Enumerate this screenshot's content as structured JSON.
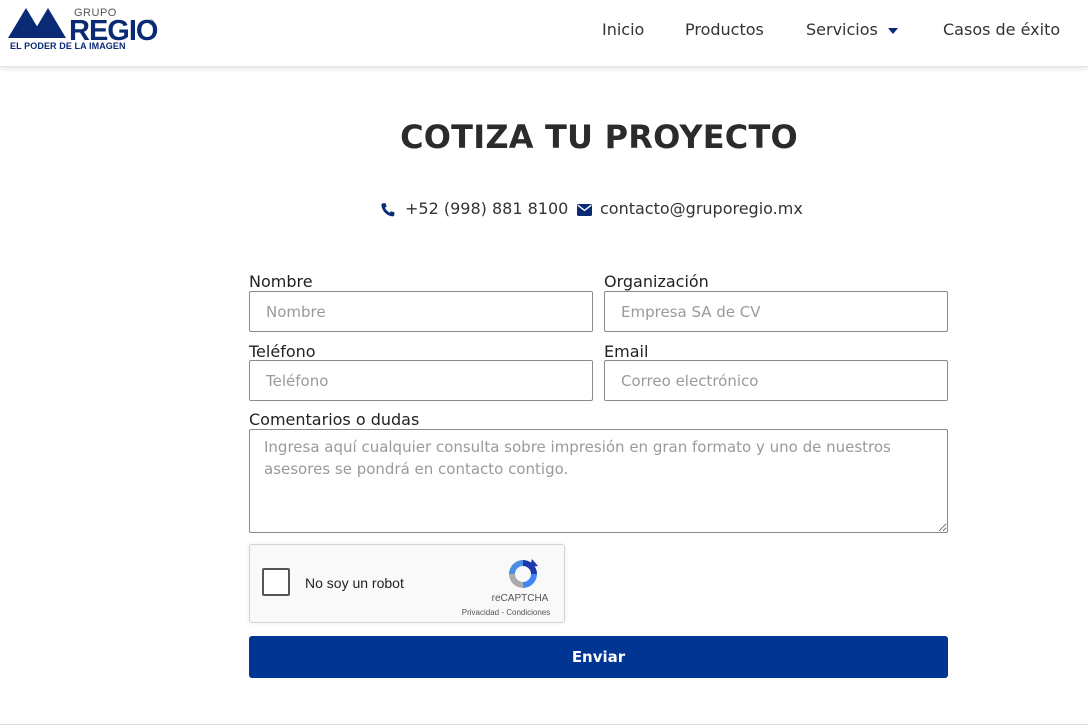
{
  "brand": {
    "name_small": "GRUPO",
    "name_large": "REGIO",
    "registered": "®",
    "tagline": "EL PODER DE LA IMAGEN",
    "color": "#0a2a75"
  },
  "nav": {
    "items": [
      "Inicio",
      "Productos",
      "Servicios",
      "Casos de éxito"
    ]
  },
  "page": {
    "title": "COTIZA TU PROYECTO",
    "phone": "+52 (998) 881 8100",
    "email": "contacto@gruporegio.mx"
  },
  "form": {
    "name": {
      "label": "Nombre",
      "placeholder": "Nombre"
    },
    "organization": {
      "label": "Organización",
      "placeholder": "Empresa SA de CV"
    },
    "phone": {
      "label": "Teléfono",
      "placeholder": "Teléfono"
    },
    "email": {
      "label": "Email",
      "placeholder": "Correo electrónico"
    },
    "comments": {
      "label": "Comentarios o dudas",
      "placeholder": "Ingresa aquí cualquier consulta sobre impresión en gran formato y uno de nuestros asesores se pondrá en contacto contigo."
    },
    "recaptcha": {
      "label": "No soy un robot",
      "brand": "reCAPTCHA",
      "links": "Privacidad - Condiciones"
    },
    "submit_label": "Enviar"
  },
  "colors": {
    "accent": "#003594",
    "icon": "#0a2a75"
  }
}
